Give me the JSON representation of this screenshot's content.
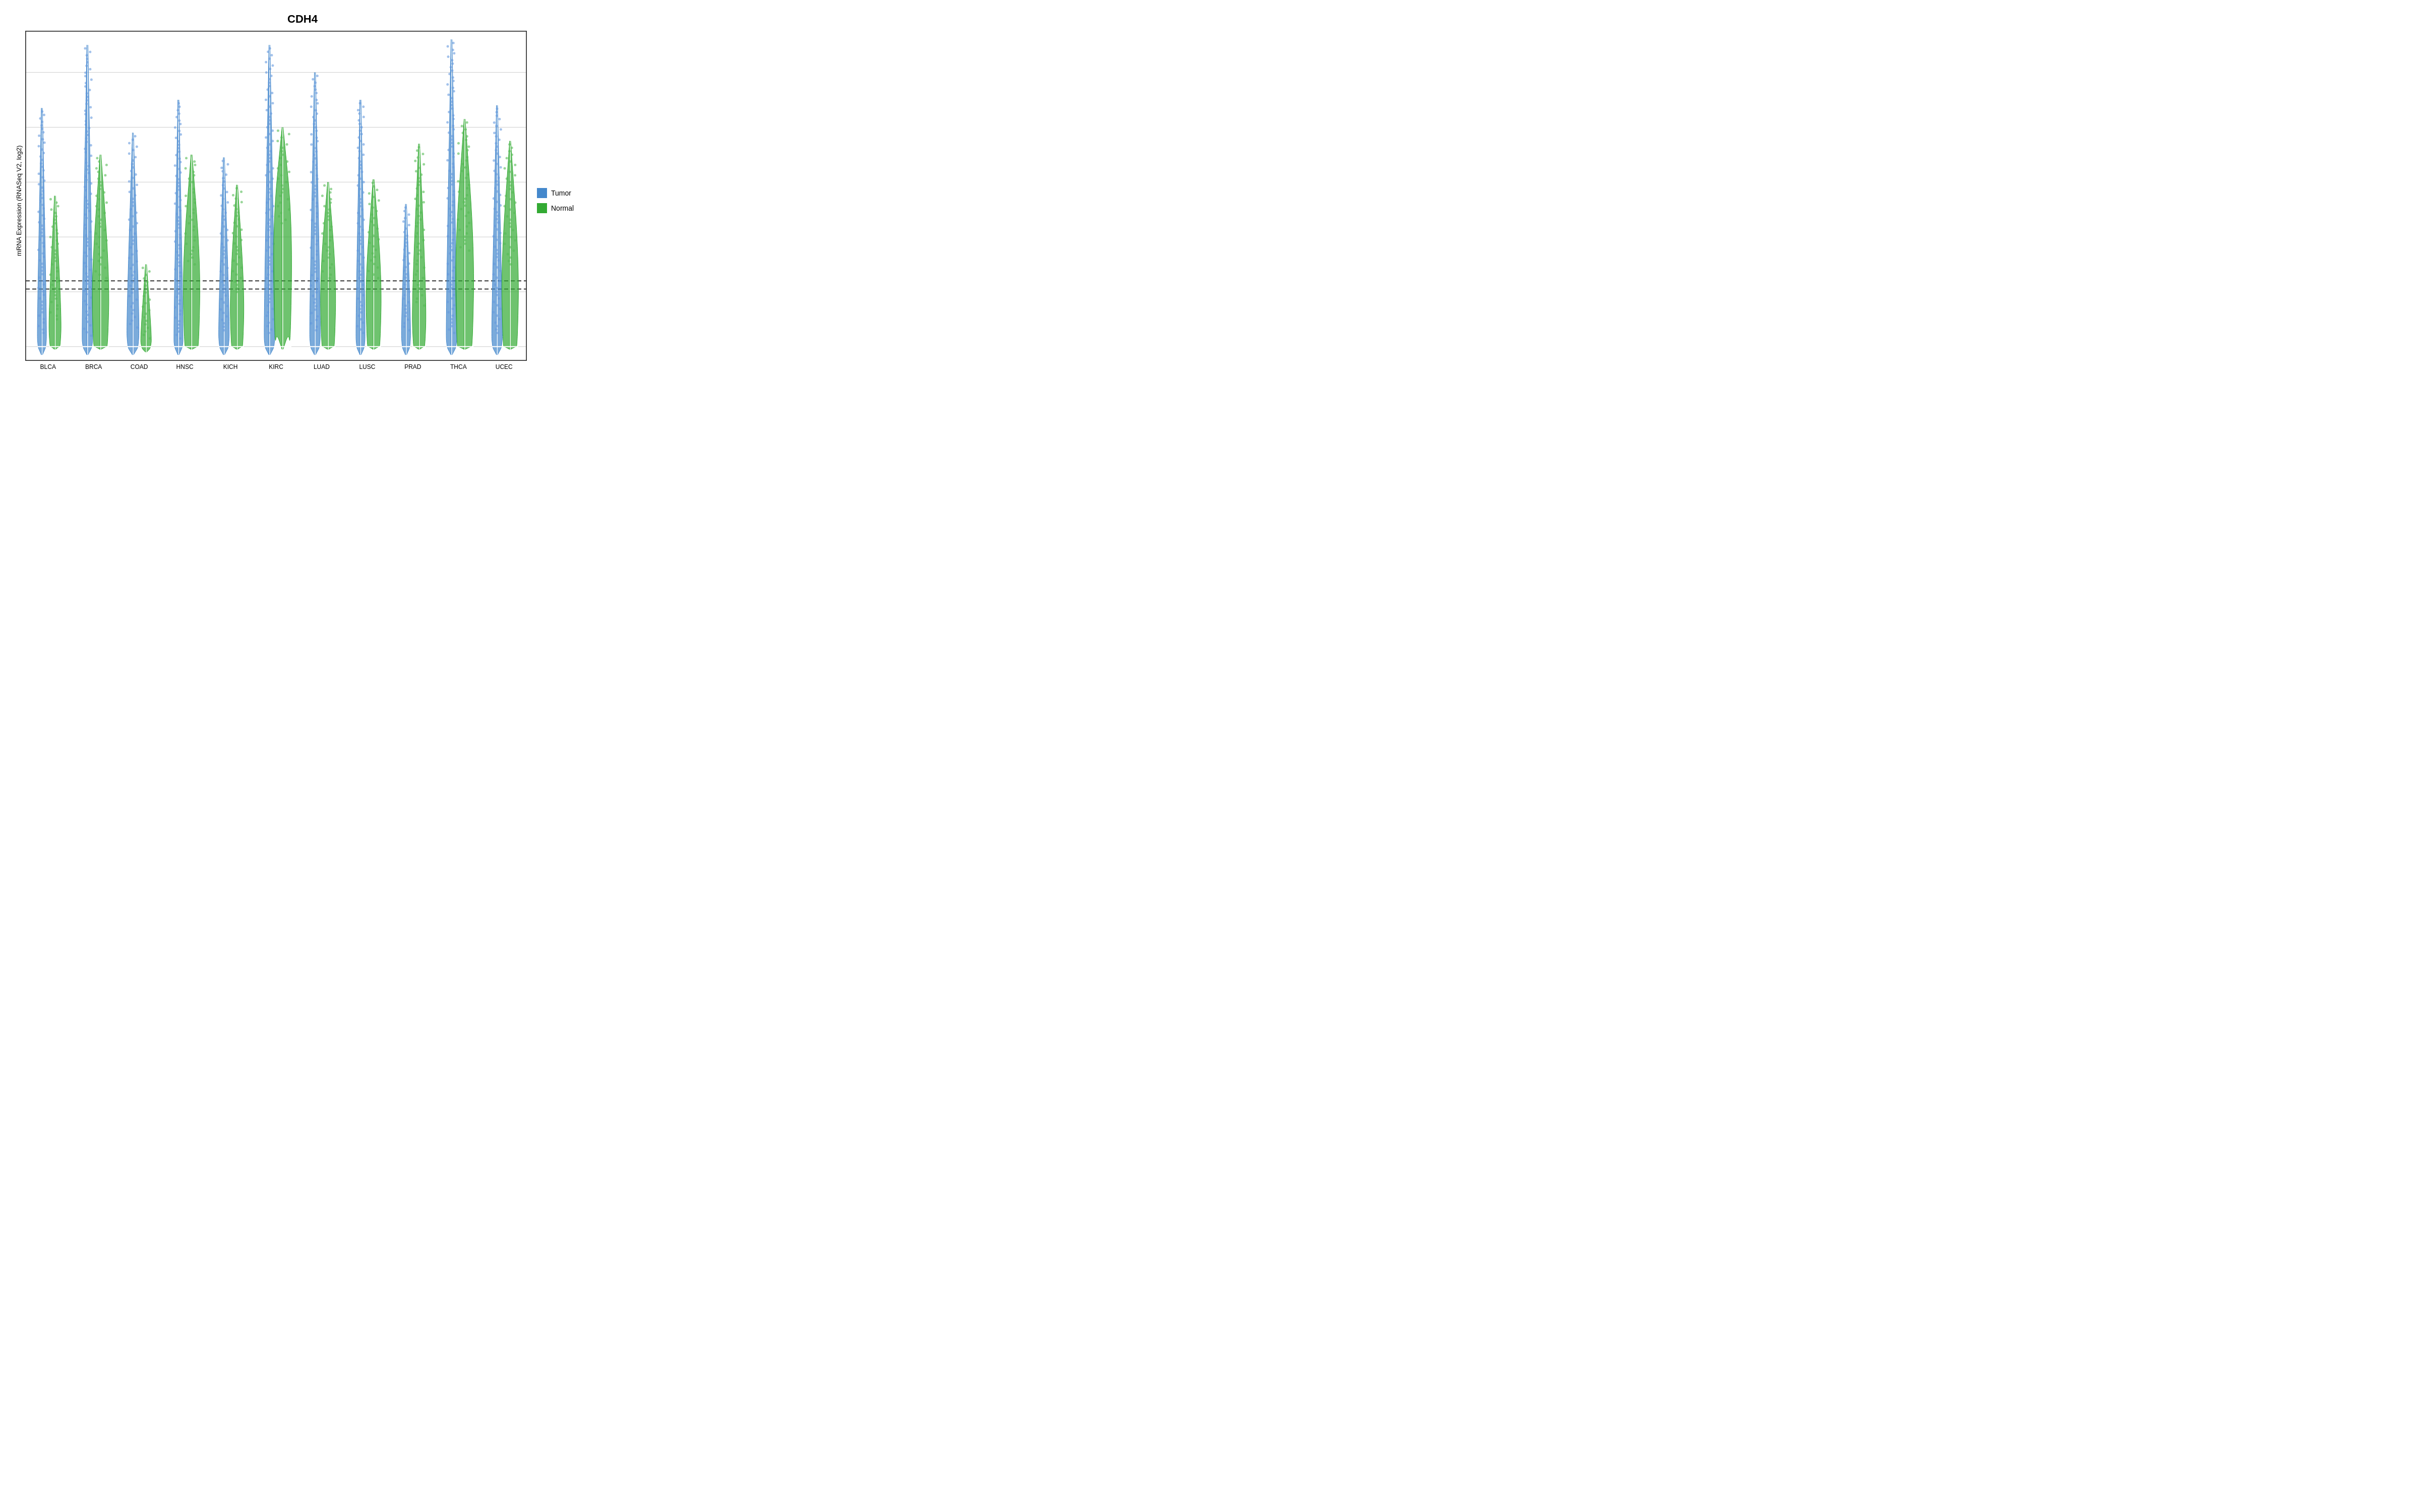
{
  "title": "CDH4",
  "yAxisLabel": "mRNA Expression (RNASeq V2, log2)",
  "yTicks": [
    "10",
    "8",
    "6",
    "4",
    "2",
    "0"
  ],
  "yTickValues": [
    10,
    8,
    6,
    4,
    2,
    0
  ],
  "yMax": 11.5,
  "yMin": -0.5,
  "referenceLines": [
    2.1,
    2.4
  ],
  "xLabels": [
    "BLCA",
    "BRCA",
    "COAD",
    "HNSC",
    "KICH",
    "KIRC",
    "LUAD",
    "LUSC",
    "PRAD",
    "THCA",
    "UCEC"
  ],
  "legend": {
    "items": [
      {
        "label": "Tumor",
        "color": "#4488cc"
      },
      {
        "label": "Normal",
        "color": "#33aa33"
      }
    ]
  },
  "colors": {
    "tumor": "#4488cc",
    "normal": "#33aa33",
    "border": "#333333"
  },
  "violins": [
    {
      "cancer": "BLCA",
      "tumor": {
        "median": 0.0,
        "q1": -0.1,
        "q3": 0.5,
        "max": 8.7,
        "min": -0.3,
        "width": 0.3
      },
      "normal": {
        "median": 0.0,
        "q1": 0.0,
        "q3": 1.0,
        "max": 5.5,
        "min": -0.1,
        "width": 0.4
      }
    },
    {
      "cancer": "BRCA",
      "tumor": {
        "median": 0.0,
        "q1": -0.1,
        "q3": 0.4,
        "max": 11.0,
        "min": -0.3,
        "width": 0.35
      },
      "normal": {
        "median": 0.0,
        "q1": 0.0,
        "q3": 2.5,
        "max": 7.0,
        "min": -0.1,
        "width": 0.55
      }
    },
    {
      "cancer": "COAD",
      "tumor": {
        "median": 0.0,
        "q1": -0.1,
        "q3": 0.7,
        "max": 7.8,
        "min": -0.3,
        "width": 0.4
      },
      "normal": {
        "median": 0.0,
        "q1": -0.1,
        "q3": 0.3,
        "max": 3.0,
        "min": -0.2,
        "width": 0.35
      }
    },
    {
      "cancer": "HNSC",
      "tumor": {
        "median": 0.0,
        "q1": -0.1,
        "q3": 0.3,
        "max": 9.0,
        "min": -0.3,
        "width": 0.3
      },
      "normal": {
        "median": 0.0,
        "q1": 0.0,
        "q3": 3.0,
        "max": 7.0,
        "min": -0.1,
        "width": 0.55
      }
    },
    {
      "cancer": "KICH",
      "tumor": {
        "median": 0.0,
        "q1": -0.1,
        "q3": 0.6,
        "max": 6.9,
        "min": -0.3,
        "width": 0.35
      },
      "normal": {
        "median": 0.0,
        "q1": 0.0,
        "q3": 2.0,
        "max": 5.9,
        "min": -0.1,
        "width": 0.45
      }
    },
    {
      "cancer": "KIRC",
      "tumor": {
        "median": 0.0,
        "q1": -0.1,
        "q3": 0.5,
        "max": 11.0,
        "min": -0.3,
        "width": 0.35
      },
      "normal": {
        "median": 0.0,
        "q1": 0.5,
        "q3": 4.5,
        "max": 8.0,
        "min": -0.1,
        "width": 0.6
      }
    },
    {
      "cancer": "LUAD",
      "tumor": {
        "median": 0.0,
        "q1": -0.1,
        "q3": 0.6,
        "max": 10.0,
        "min": -0.3,
        "width": 0.35
      },
      "normal": {
        "median": 0.0,
        "q1": 0.0,
        "q3": 2.5,
        "max": 6.0,
        "min": -0.1,
        "width": 0.5
      }
    },
    {
      "cancer": "LUSC",
      "tumor": {
        "median": 0.0,
        "q1": -0.1,
        "q3": 0.5,
        "max": 9.0,
        "min": -0.3,
        "width": 0.3
      },
      "normal": {
        "median": 0.0,
        "q1": 0.0,
        "q3": 2.5,
        "max": 6.1,
        "min": -0.1,
        "width": 0.5
      }
    },
    {
      "cancer": "PRAD",
      "tumor": {
        "median": 0.0,
        "q1": -0.1,
        "q3": 0.6,
        "max": 5.2,
        "min": -0.3,
        "width": 0.3
      },
      "normal": {
        "median": 0.0,
        "q1": 0.0,
        "q3": 1.5,
        "max": 7.4,
        "min": -0.1,
        "width": 0.45
      }
    },
    {
      "cancer": "THCA",
      "tumor": {
        "median": 0.0,
        "q1": -0.1,
        "q3": 0.5,
        "max": 11.2,
        "min": -0.3,
        "width": 0.35
      },
      "normal": {
        "median": 0.0,
        "q1": 0.0,
        "q3": 3.5,
        "max": 8.3,
        "min": -0.1,
        "width": 0.6
      }
    },
    {
      "cancer": "UCEC",
      "tumor": {
        "median": 0.0,
        "q1": -0.1,
        "q3": 0.5,
        "max": 8.8,
        "min": -0.3,
        "width": 0.35
      },
      "normal": {
        "median": 0.0,
        "q1": 0.0,
        "q3": 3.0,
        "max": 7.5,
        "min": -0.1,
        "width": 0.55
      }
    }
  ]
}
